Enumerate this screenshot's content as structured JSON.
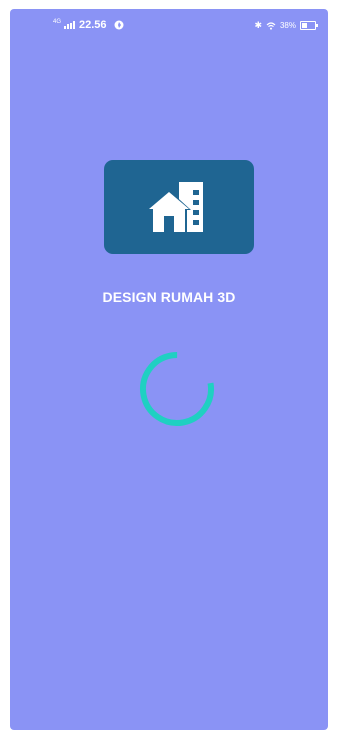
{
  "status_bar": {
    "network": "4G",
    "time": "22.56",
    "battery_percent": "38%",
    "battery_level": 0.38,
    "icons": [
      "signal-icon",
      "notification-icon",
      "bluetooth-icon",
      "wifi-icon",
      "battery-icon"
    ]
  },
  "splash": {
    "title": "DESIGN RUMAH 3D",
    "logo_icon": "house-building-icon",
    "loading_icon": "loading-spinner-icon"
  },
  "colors": {
    "background": "#8a93f5",
    "logo_box": "#1f6592",
    "spinner": "#1fd0c2",
    "text": "#ffffff"
  }
}
